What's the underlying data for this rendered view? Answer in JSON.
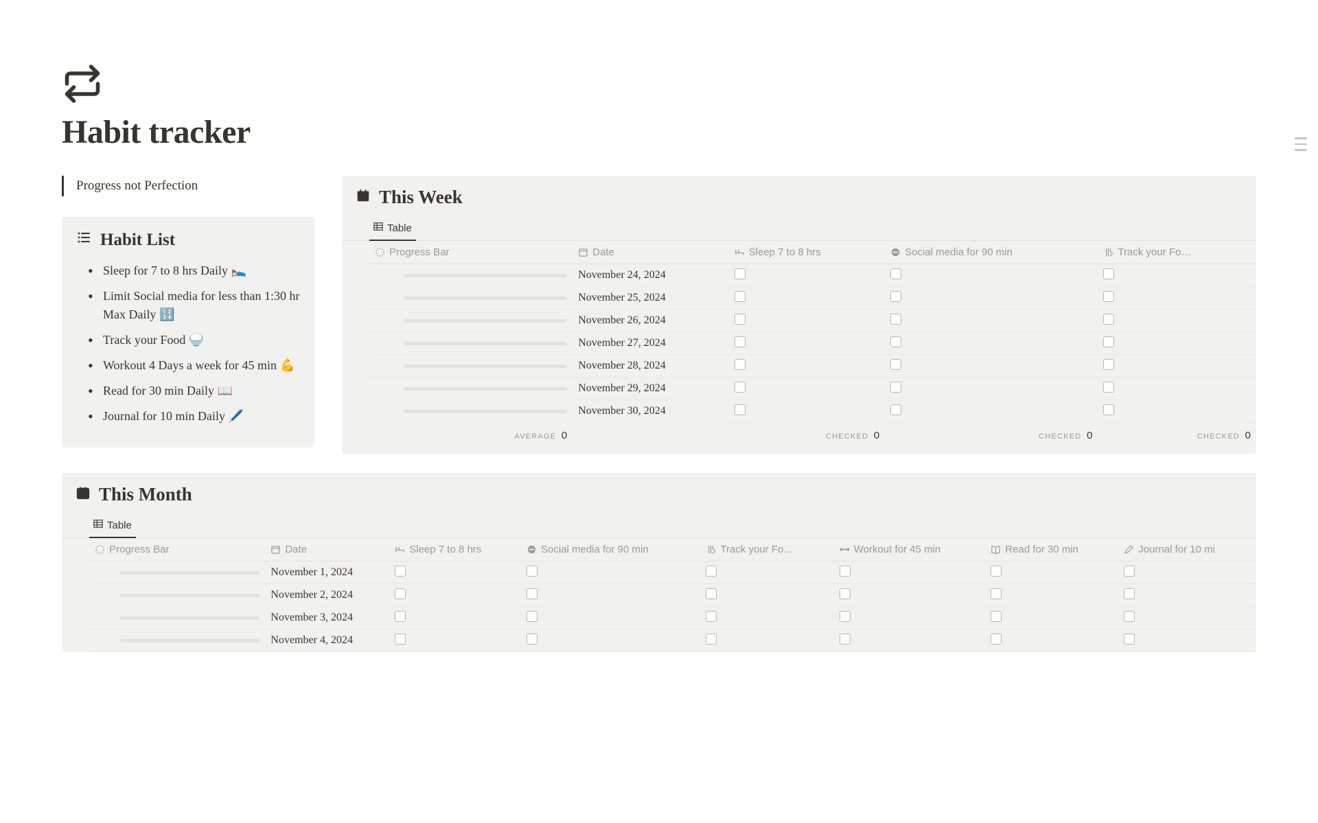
{
  "page": {
    "title": "Habit tracker",
    "quote": "Progress not Perfection"
  },
  "habit_list": {
    "title": "Habit List",
    "items": [
      "Sleep for 7 to 8 hrs Daily 🛌",
      "Limit Social media for less than 1:30 hr Max Daily 🔢",
      "Track your Food 🍚",
      "Workout 4 Days a week for 45 min 💪",
      "Read for 30 min Daily 📖",
      "Journal for 10 min Daily 🖊️"
    ]
  },
  "week": {
    "title": "This Week",
    "view_tab": "Table",
    "columns": {
      "progress": "Progress Bar",
      "date": "Date",
      "sleep": "Sleep 7 to 8 hrs",
      "social": "Social media for 90 min",
      "track": "Track your Fo…"
    },
    "rows": [
      {
        "date": "November 24, 2024"
      },
      {
        "date": "November 25, 2024"
      },
      {
        "date": "November 26, 2024"
      },
      {
        "date": "November 27, 2024"
      },
      {
        "date": "November 28, 2024"
      },
      {
        "date": "November 29, 2024"
      },
      {
        "date": "November 30, 2024"
      }
    ],
    "footer": {
      "avg_label": "AVERAGE",
      "avg_val": "0",
      "chk_label": "CHECKED",
      "chk_val": "0"
    }
  },
  "month": {
    "title": "This Month",
    "view_tab": "Table",
    "columns": {
      "progress": "Progress Bar",
      "date": "Date",
      "sleep": "Sleep 7 to 8 hrs",
      "social": "Social media for 90 min",
      "track": "Track your Fo…",
      "workout": "Workout for 45 min",
      "read": "Read for 30 min",
      "journal": "Journal for 10 mi"
    },
    "rows": [
      {
        "date": "November 1, 2024"
      },
      {
        "date": "November 2, 2024"
      },
      {
        "date": "November 3, 2024"
      },
      {
        "date": "November 4, 2024"
      }
    ]
  }
}
